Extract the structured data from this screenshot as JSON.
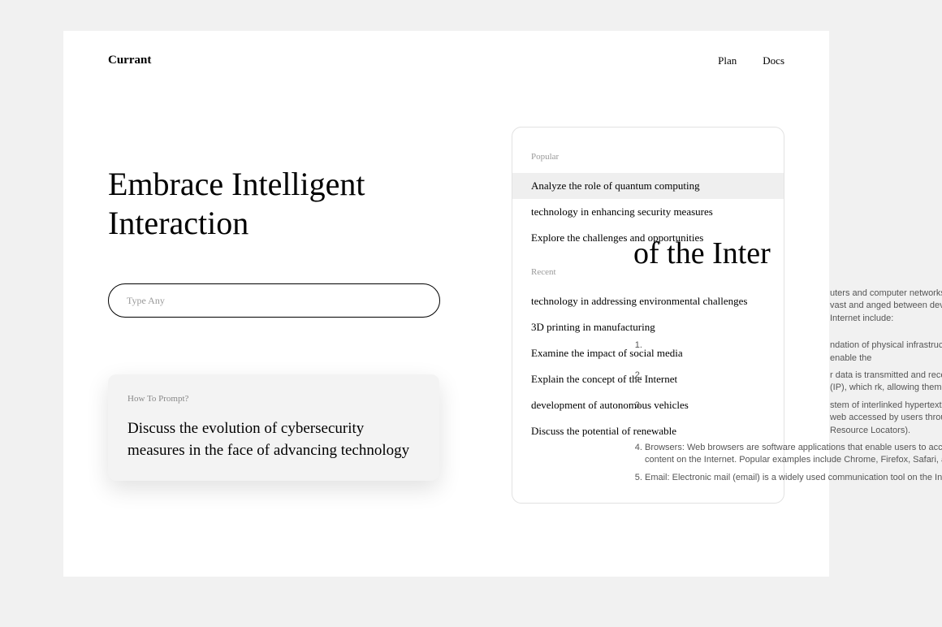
{
  "header": {
    "logo": "Currant",
    "nav": {
      "plan": "Plan",
      "docs": "Docs"
    }
  },
  "hero": {
    "title": "Embrace Intelligent Interaction",
    "search_placeholder": "Type Any"
  },
  "prompt_card": {
    "label": "How To Prompt?",
    "text": "Discuss the evolution of cybersecurity measures in the face of advancing technology"
  },
  "sidebar": {
    "popular_label": "Popular",
    "popular": [
      "Analyze the role of quantum computing",
      "technology in enhancing security measures",
      "Explore the challenges and opportunities"
    ],
    "recent_label": "Recent",
    "recent": [
      "technology in addressing environmental challenges",
      "3D printing in manufacturing",
      "Examine the impact of social media",
      "Explain the concept of the Internet",
      "development of autonomous vehicles",
      "Discuss the potential of renewable"
    ]
  },
  "doc": {
    "title_fragment": "of the Inter",
    "intro": "uters and computer networks set of protocols. It is a vast and anged between devices located o the Internet include:",
    "items": [
      "ndation of physical infrastructu se components enable the",
      "r data is transmitted and receiv he Internet Protocol (IP), which rk, allowing them to",
      "stem of interlinked hypertext ia the Internet using web accessed by users through URL (Uniform Resource Locators).",
      "Browsers: Web browsers are software applications that enable users to access and interact with content on the Internet. Popular examples include Chrome, Firefox, Safari, and Edge.",
      "Email: Electronic mail (email) is a widely used communication tool on the Internet. It"
    ]
  }
}
